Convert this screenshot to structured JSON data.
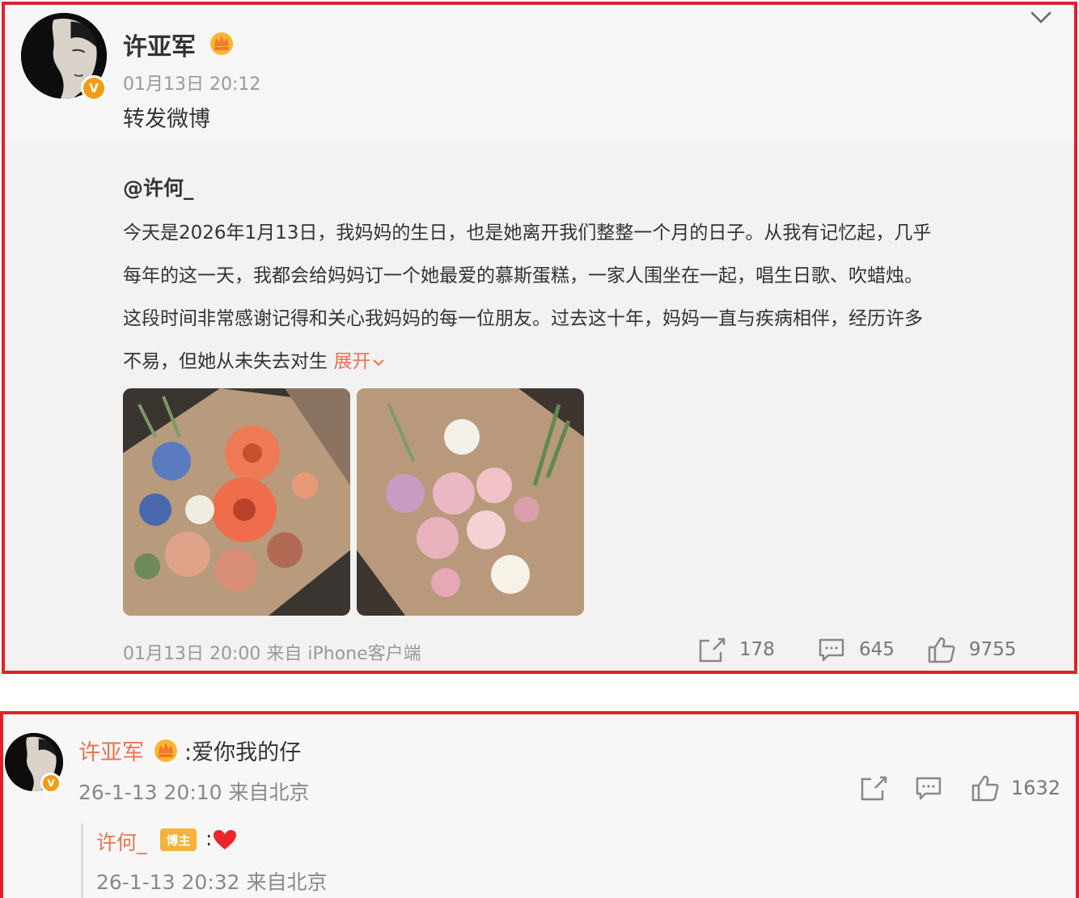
{
  "post": {
    "author": "许亚军",
    "timestamp": "01月13日 20:12",
    "repost_label": "转发微博",
    "original": {
      "mention": "@许何_",
      "text_lines": [
        "今天是2026年1月13日，我妈妈的生日，也是她离开我们整整一个月的日子。从我有记忆起，几乎",
        "每年的这一天，我都会给妈妈订一个她最爱的慕斯蛋糕，一家人围坐在一起，唱生日歌、吹蜡烛。",
        "这段时间非常感谢记得和关心我妈妈的每一位朋友。过去这十年，妈妈一直与疾病相伴，经历许多",
        "不易，但她从未失去对生"
      ],
      "expand_label": "展开",
      "images": [
        "flower-bouquet-photo",
        "pink-flower-bouquet-photo"
      ],
      "footer_info": "01月13日 20:00 来自 iPhone客户端",
      "repost_count": "178",
      "comment_count": "645",
      "like_count": "9755"
    }
  },
  "comment": {
    "author": "许亚军",
    "text": ":爱你我的仔",
    "meta": "26-1-13 20:10 来自北京",
    "like_count": "1632",
    "reply": {
      "author": "许何_",
      "badge": "博主",
      "colon": ":",
      "meta": "26-1-13 20:32 来自北京"
    }
  },
  "colors": {
    "highlight_border": "#e0212b",
    "link_orange": "#eb7350",
    "verified_badge": "#f39c12"
  },
  "icons": [
    "avatar",
    "verified-icon",
    "crown-icon",
    "chevron-down-icon",
    "repost-icon",
    "comment-icon",
    "like-icon",
    "heart-icon"
  ]
}
